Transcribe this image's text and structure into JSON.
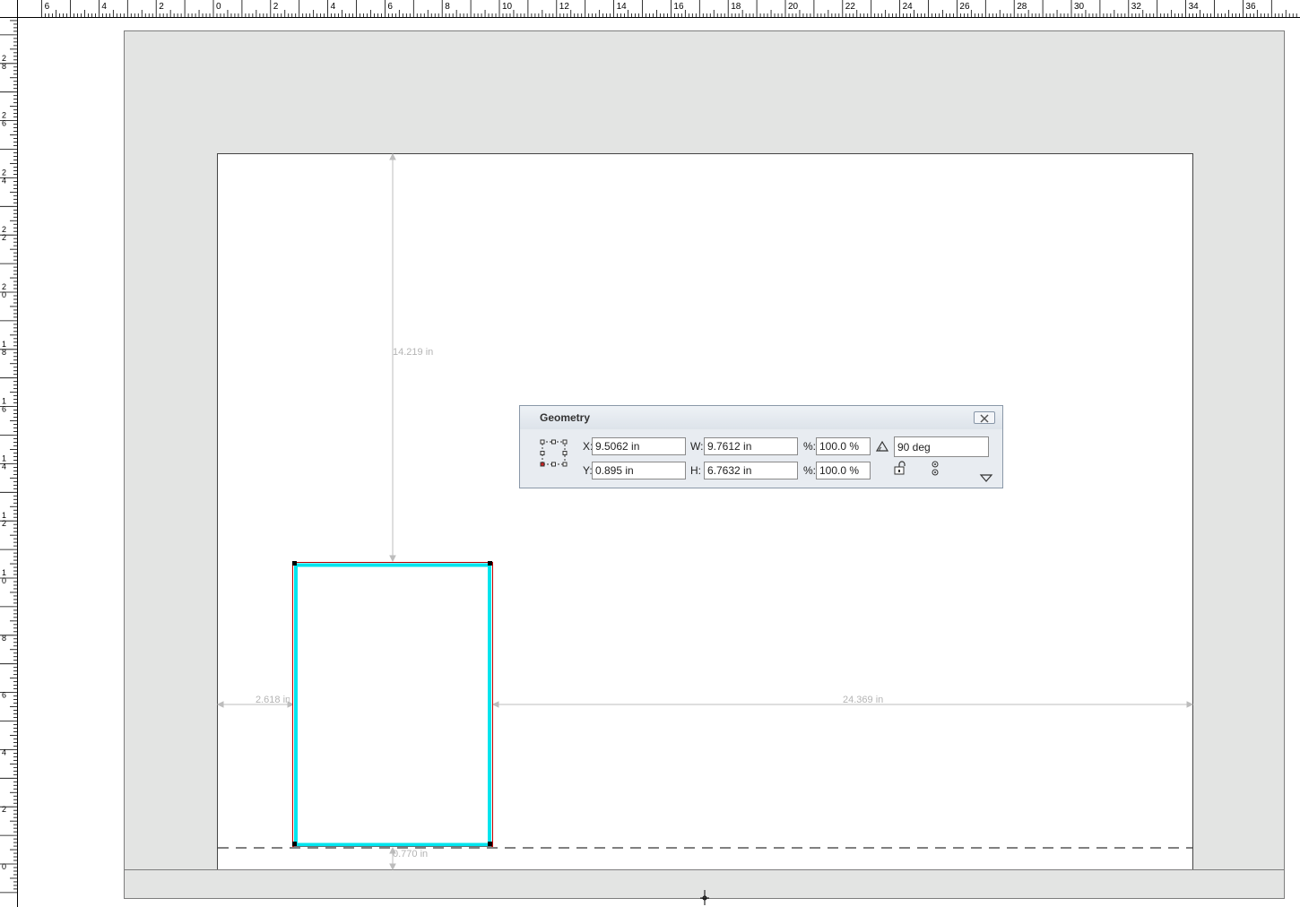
{
  "rulers": {
    "top_labels": [
      "6",
      "4",
      "2",
      "0",
      "2",
      "4",
      "6",
      "8",
      "10",
      "12",
      "14",
      "16",
      "18",
      "20",
      "22",
      "24",
      "26",
      "28",
      "30",
      "32",
      "34",
      "36"
    ],
    "left_labels": [
      "28",
      "26",
      "24",
      "22",
      "20",
      "18",
      "16",
      "14",
      "12",
      "10",
      "8",
      "6",
      "4",
      "2",
      "0"
    ]
  },
  "measurements": {
    "top_distance": "14.219 in",
    "left_distance": "2.618 in",
    "right_distance": "24.369 in",
    "bottom_distance": "0.770 in"
  },
  "geometry_panel": {
    "title": "Geometry",
    "x_label": "X:",
    "x_value": "9.5062 in",
    "y_label": "Y:",
    "y_value": "0.895 in",
    "w_label": "W:",
    "w_value": "9.7612 in",
    "h_label": "H:",
    "h_value": "6.7632 in",
    "scale_x_label": "%:",
    "scale_x_value": "100.0 %",
    "scale_y_label": "%:",
    "scale_y_value": "100.0 %",
    "rotation_value": "90 deg",
    "icons": [
      "reference-point-icon",
      "rotation-angle-icon",
      "lock-icon",
      "link-proportions-icon",
      "expand-triangle-icon",
      "close-icon"
    ]
  },
  "colors": {
    "selection_outline": "#c00000",
    "frame_stroke": "#00e5ee",
    "pasteboard": "#e3e4e3",
    "measure_line": "#bdbdbd"
  }
}
